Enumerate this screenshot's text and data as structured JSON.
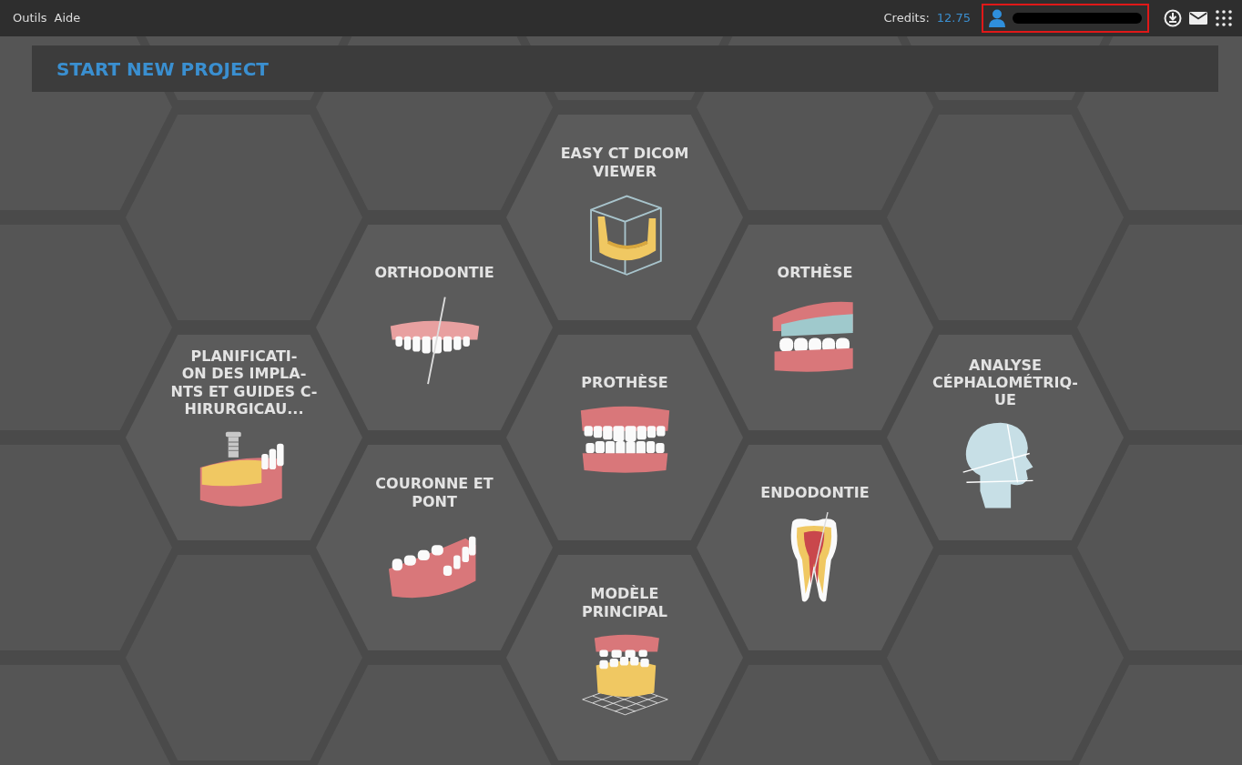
{
  "menu": [
    "Outils",
    "Aide"
  ],
  "credits": {
    "label": "Credits:",
    "value": "12.75"
  },
  "header": {
    "title": "START NEW PROJECT"
  },
  "tiles": [
    {
      "label": "EASY CT DICOM\nVIEWER",
      "kind": "cube"
    },
    {
      "label": "ORTHODONTIE",
      "kind": "split"
    },
    {
      "label": "ORTHÈSE",
      "kind": "splint"
    },
    {
      "label": "PLANIFICATI-\nON DES IMPLA-\nNTS ET GUIDES C-\nHIRURGICAU...",
      "kind": "implant"
    },
    {
      "label": "PROTHÈSE",
      "kind": "denture"
    },
    {
      "label": "ANALYSE\nCÉPHALOMÉTRIQ-\nUE",
      "kind": "head"
    },
    {
      "label": "COURONNE ET\nPONT",
      "kind": "bridge"
    },
    {
      "label": "ENDODONTIE",
      "kind": "tooth"
    },
    {
      "label": "MODÈLE\nPRINCIPAL",
      "kind": "model"
    }
  ]
}
